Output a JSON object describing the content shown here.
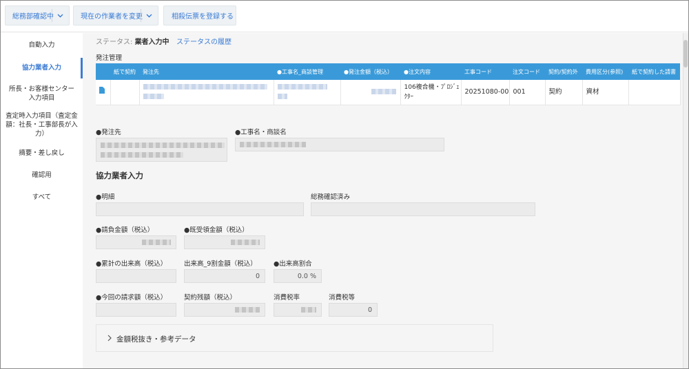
{
  "toolbar": {
    "status_dropdown": "総務部確認中",
    "change_worker": "現在の作業者を変更",
    "register_offset": "相殺伝票を登録する"
  },
  "sidebar": {
    "items": [
      {
        "label": "自動入力"
      },
      {
        "label": "協力業者入力"
      },
      {
        "label": "所長・お客様センター入力項目"
      },
      {
        "label": "査定時入力項目（査定金額：社長・工事部長が入力）"
      },
      {
        "label": "摘要・差し戻し"
      },
      {
        "label": "確認用"
      },
      {
        "label": "すべて"
      }
    ],
    "active_index": 1
  },
  "status": {
    "label": "ステータス:",
    "value": "業者入力中",
    "history_link": "ステータスの履歴"
  },
  "order_section": {
    "label": "発注管理",
    "columns": [
      "紙で契約",
      "発注先",
      "●工事名_商談管理",
      "●発注金額（税込）",
      "●注文内容",
      "工事コード",
      "注文コード",
      "契約/契約外",
      "費用区分(参照)",
      "紙で契約した請書"
    ],
    "rows": [
      {
        "paper_contract": "",
        "supplier": "",
        "project": "",
        "amount": "",
        "content": "106複合機・ﾌﾟﾛｼﾞｪｸﾀｰ",
        "project_code": "20251080-00",
        "order_code": "001",
        "contract": "契約",
        "cost_category": "資材",
        "paper_doc": ""
      }
    ]
  },
  "fields": {
    "supplier_label": "●発注先",
    "project_label": "●工事名・商談名",
    "detail_label": "●明細",
    "general_affairs_label": "総務確認済み",
    "contract_amount_label": "●請負金額（税込）",
    "received_amount_label": "●既受領金額（税込）",
    "cumulative_label": "●累計の出来高（税込）",
    "progress90_label": "出来高_9割金額（税込）",
    "progress90_value": "0",
    "progress_ratio_label": "●出来高割合",
    "progress_ratio_value": "0.0 %",
    "current_invoice_label": "●今回の請求額（税込）",
    "contract_balance_label": "契約残額（税込）",
    "tax_rate_label": "消費税率",
    "tax_amount_label": "消費税等",
    "tax_amount_value": "0"
  },
  "partner_section_title": "協力業者入力",
  "accordion": {
    "label": "金額税抜き・参考データ"
  },
  "colors": {
    "accent": "#3a7bd5",
    "table_header": "#3a9ad9",
    "main_bg": "#f5f5f5",
    "field_bg": "#ebebeb"
  }
}
